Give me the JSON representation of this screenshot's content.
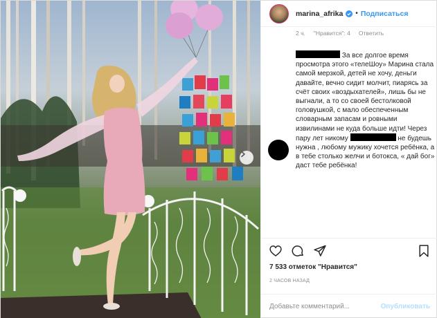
{
  "header": {
    "username": "marina_afrika",
    "separator": "•",
    "follow_label": "Подписаться"
  },
  "comment": {
    "meta": {
      "time": "2 ч.",
      "likes": "\"Нравится\": 4",
      "reply": "Ответить"
    },
    "text_part1": " За все долгое время просмотра этого «телеШоу» Марина стала самой мерзкой, детей не хочу, деньги давайте, вечно сидит молчит, пиарясь за счёт своих «воздыхателей», лишь бы не выгнали, а то со своей бестолковой головушкой, с мало обеспеченным словарным запасам и ровными извилинами не куда больше идти! Через пару лет никому ",
    "text_part2": " не будешь нужна , любому мужику хочется ребёнка, а в тебе столько желчи и ботокса, « дай бог» даст тебе ребёнка!"
  },
  "footer": {
    "likes_count": "7 533 отметок \"Нравится\"",
    "time_ago": "2 ЧАСОВ НАЗАД",
    "comment_placeholder": "Добавьте комментарий...",
    "publish_label": "Опубликовать"
  },
  "icons": {
    "like": "heart-icon",
    "comment": "comment-icon",
    "share": "share-icon",
    "save": "bookmark-icon",
    "verified": "verified-badge-icon",
    "next": "chevron-right-icon"
  },
  "colors": {
    "accent": "#3897f0",
    "publish_disabled": "#b2dffc",
    "muted": "#8e8e8e",
    "text": "#262626"
  }
}
